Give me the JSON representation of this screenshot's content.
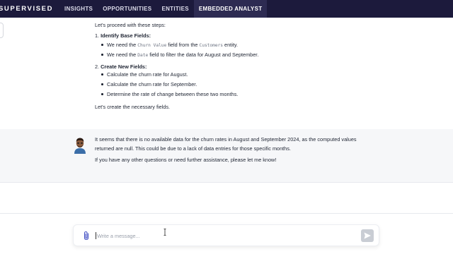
{
  "nav": {
    "brand": "SUPERVISED",
    "tabs": [
      {
        "label": "INSIGHTS"
      },
      {
        "label": "OPPORTUNITIES"
      },
      {
        "label": "ENTITIES"
      },
      {
        "label": "EMBEDDED ANALYST",
        "active": true
      }
    ]
  },
  "analyst_message": {
    "intro": "Let's proceed with these steps:",
    "step1": {
      "title": "Identify Base Fields:",
      "b1_pre": "We need the ",
      "b1_code": "Churn Value",
      "b1_mid": " field from the ",
      "b1_code2": "Customers",
      "b1_post": " entity.",
      "b2_pre": "We need the ",
      "b2_code": "Date",
      "b2_post": " field to filter the data for August and September."
    },
    "step2": {
      "title": "Create New Fields:",
      "b1": "Calculate the churn rate for August.",
      "b2": "Calculate the churn rate for September.",
      "b3": "Determine the rate of change between these two months."
    },
    "outro": "Let's create the necessary fields."
  },
  "response_message": {
    "line1": "It seems that there is no available data for the churn rates in August and September 2024, as the computed values",
    "line2": "returned are null. This could be due to a lack of data entries for those specific months.",
    "line3": "If you have any other questions or need further assistance, please let me know!"
  },
  "composer": {
    "placeholder": "Write a message...",
    "attach_icon": "paperclip-icon",
    "send_icon": "send-icon"
  }
}
